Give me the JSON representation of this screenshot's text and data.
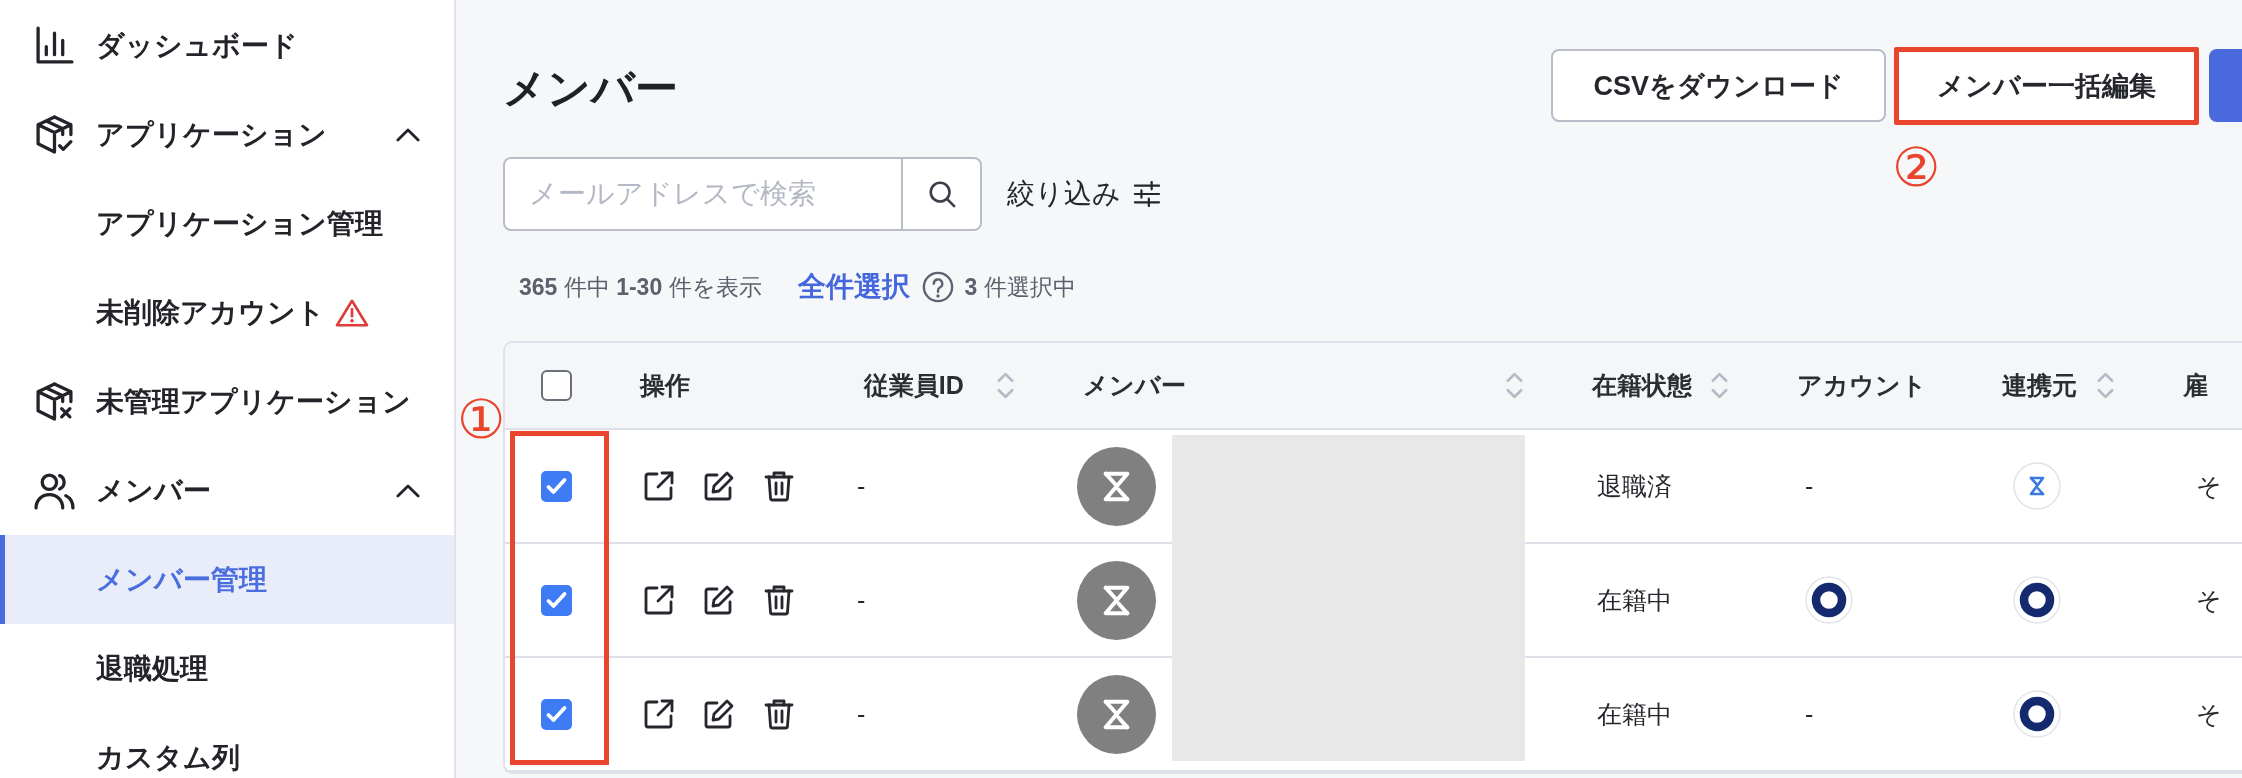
{
  "sidebar": {
    "items": [
      {
        "label": "ダッシュボード",
        "selected": false
      },
      {
        "label": "アプリケーション",
        "selected": false,
        "expanded": true,
        "children": [
          {
            "label": "アプリケーション管理",
            "selected": false,
            "warning": false
          },
          {
            "label": "未削除アカウント",
            "selected": false,
            "warning": true
          }
        ]
      },
      {
        "label": "未管理アプリケーション",
        "selected": false
      },
      {
        "label": "メンバー",
        "selected": false,
        "expanded": true,
        "children": [
          {
            "label": "メンバー管理",
            "selected": true,
            "warning": false
          },
          {
            "label": "退職処理",
            "selected": false,
            "warning": false
          },
          {
            "label": "カスタム列",
            "selected": false,
            "warning": false
          }
        ]
      }
    ]
  },
  "header": {
    "title": "メンバー",
    "buttons": [
      {
        "kind": "outline",
        "label": "CSVをダウンロード"
      },
      {
        "kind": "outline",
        "label": "メンバー一括編集",
        "annotation": "②"
      },
      {
        "kind": "primary"
      }
    ]
  },
  "toolbar": {
    "search": {
      "placeholder": "メールアドレスで検索"
    },
    "filter": {
      "label": "絞り込み"
    }
  },
  "summary": {
    "count": "**365** 件中 **1-30** 件を表示",
    "select_all": "全件選択",
    "selected": "**3** 件選択中"
  },
  "table": {
    "annotation": "①",
    "header_checked": false,
    "names_redacted": true,
    "columns": [
      {
        "label": "操作",
        "sortable": false
      },
      {
        "label": "従業員ID",
        "sortable": true
      },
      {
        "label": "メンバー",
        "sortable": true
      },
      {
        "label": "在籍状態",
        "sortable": true
      },
      {
        "label": "アカウント",
        "sortable": false
      },
      {
        "label": "連携元",
        "sortable": true
      },
      {
        "label": "雇",
        "sortable": false
      }
    ],
    "rows": [
      {
        "checked": true,
        "employee_id": "-",
        "status": "退職済",
        "account": {
          "kind": "text",
          "text": "-"
        },
        "source": {
          "kind": "hourglass"
        },
        "column_7": "そ"
      },
      {
        "checked": true,
        "employee_id": "-",
        "status": "在籍中",
        "account": {
          "kind": "ring"
        },
        "source": {
          "kind": "ring"
        },
        "column_7": "そ"
      },
      {
        "checked": true,
        "employee_id": "-",
        "status": "在籍中",
        "account": {
          "kind": "text",
          "text": "-"
        },
        "source": {
          "kind": "ring"
        },
        "column_7": "そ"
      }
    ]
  }
}
